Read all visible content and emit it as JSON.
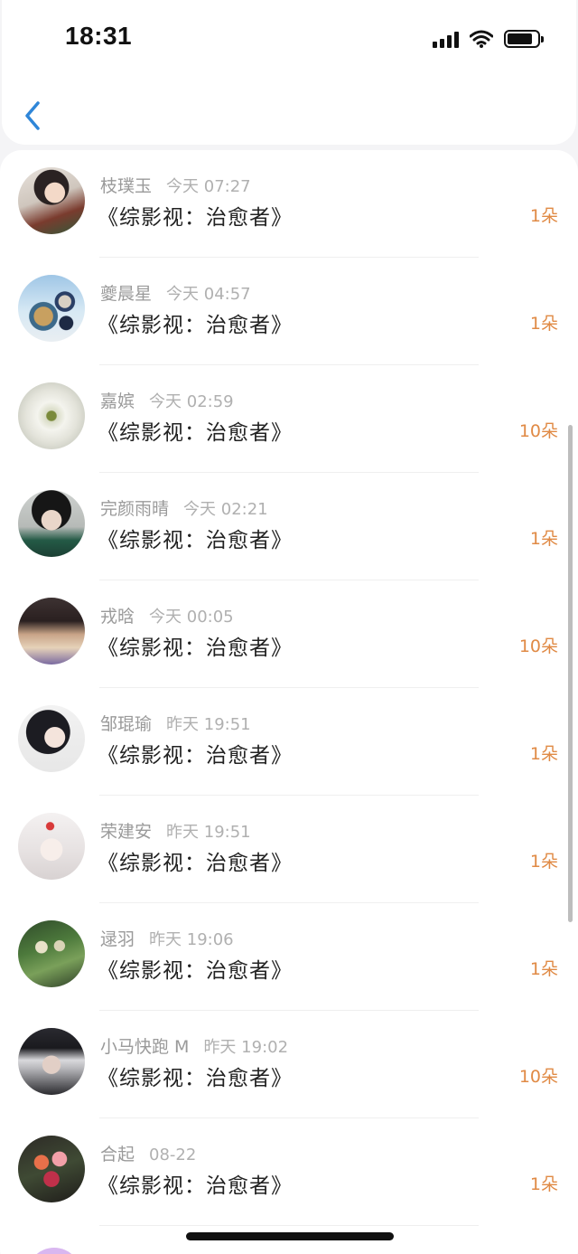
{
  "status_bar": {
    "time": "18:31",
    "battery_level": 0.85
  },
  "nav": {
    "back_icon": "chevron-left-icon",
    "accent": "#2f86d8"
  },
  "colors": {
    "name_gray": "#9a9a9a",
    "count_orange": "#e08a45"
  },
  "items": [
    {
      "name": "枝璞玉",
      "time": "今天 07:27",
      "book": "《综影视：治愈者》",
      "count": "1朵",
      "avatar_icon": "portrait-woman-icon"
    },
    {
      "name": "夔晨星",
      "time": "今天 04:57",
      "book": "《综影视：治愈者》",
      "count": "1朵",
      "avatar_icon": "food-bowls-icon"
    },
    {
      "name": "嘉嫔",
      "time": "今天 02:59",
      "book": "《综影视：治愈者》",
      "count": "10朵",
      "avatar_icon": "white-flower-icon"
    },
    {
      "name": "完颜雨晴",
      "time": "今天 02:21",
      "book": "《综影视：治愈者》",
      "count": "1朵",
      "avatar_icon": "portrait-scarf-icon"
    },
    {
      "name": "戎晗",
      "time": "今天 00:05",
      "book": "《综影视：治愈者》",
      "count": "10朵",
      "avatar_icon": "hat-icon"
    },
    {
      "name": "邹琨瑜",
      "time": "昨天 19:51",
      "book": "《综影视：治愈者》",
      "count": "1朵",
      "avatar_icon": "anime-girl-icon"
    },
    {
      "name": "荣建安",
      "time": "昨天 19:51",
      "book": "《综影视：治愈者》",
      "count": "1朵",
      "avatar_icon": "anime-white-hair-icon"
    },
    {
      "name": "逯羽",
      "time": "昨天 19:06",
      "book": "《综影视：治愈者》",
      "count": "1朵",
      "avatar_icon": "plants-icon"
    },
    {
      "name": "小马快跑 M",
      "time": "昨天 19:02",
      "book": "《综影视：治愈者》",
      "count": "10朵",
      "avatar_icon": "portrait-mask-icon"
    },
    {
      "name": "合起",
      "time": "08-22",
      "book": "《综影视：治愈者》",
      "count": "1朵",
      "avatar_icon": "flower-bouquet-icon"
    }
  ]
}
